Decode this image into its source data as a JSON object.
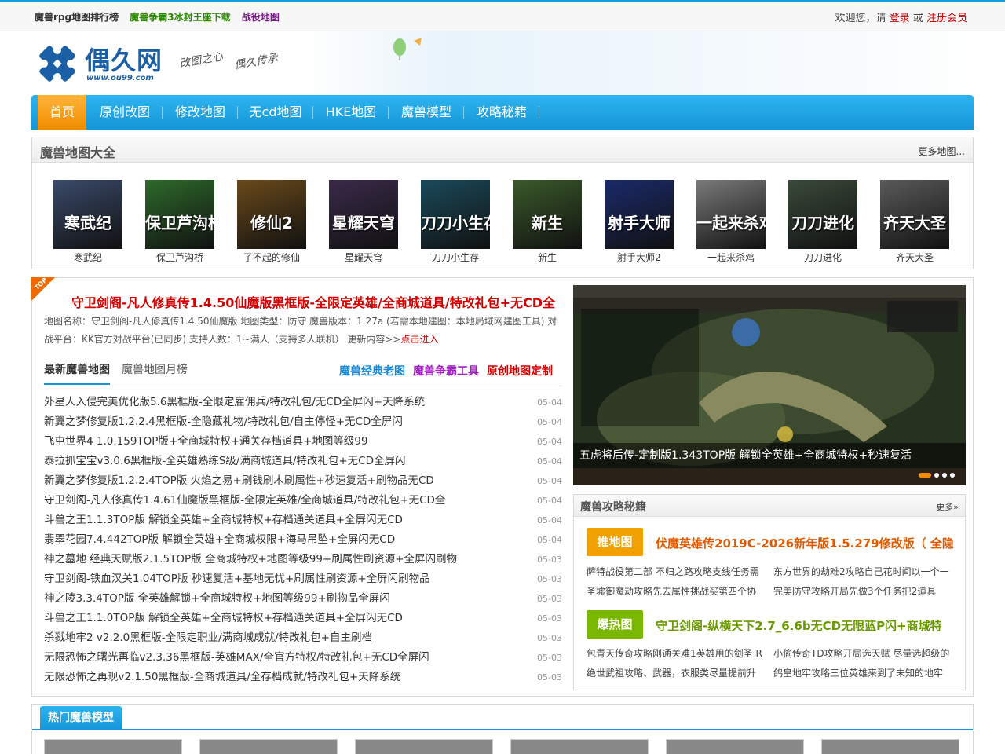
{
  "topbar": {
    "links": [
      {
        "label": "魔兽rpg地图排行榜",
        "color": "#333333"
      },
      {
        "label": "魔兽争霸3冰封王座下载",
        "color": "#2a8a00"
      },
      {
        "label": "战役地图",
        "color": "#7a1a8a"
      }
    ],
    "welcome": "欢迎您，请",
    "login": "登录",
    "or": "或",
    "register": "注册会员"
  },
  "header": {
    "logo_text": "偶久网",
    "logo_url": "www.ou99.com",
    "slogan_1": "改图之心",
    "slogan_2": "偶久传承"
  },
  "nav": {
    "items": [
      "首页",
      "原创改图",
      "修改地图",
      "无cd地图",
      "HKE地图",
      "魔兽模型",
      "攻略秘籍"
    ]
  },
  "maps_section": {
    "title": "魔兽地图大全",
    "more": "更多地图...",
    "items": [
      {
        "label": "寒武纪",
        "color": "#3a4a6a",
        "art": "寒武纪"
      },
      {
        "label": "保卫芦沟桥",
        "color": "#2d6a2a",
        "art": "保卫芦沟桥"
      },
      {
        "label": "了不起的修仙",
        "color": "#6a4a1a",
        "art": "修仙2"
      },
      {
        "label": "星耀天穹",
        "color": "#3a2a4a",
        "art": "星耀天穹"
      },
      {
        "label": "刀刀小生存",
        "color": "#1a4a5a",
        "art": "刀刀小生存"
      },
      {
        "label": "新生",
        "color": "#3a5a2a",
        "art": "新生"
      },
      {
        "label": "射手大师2",
        "color": "#1a2a6a",
        "art": "射手大师"
      },
      {
        "label": "一起来杀鸡",
        "color": "#7a7a7a",
        "art": "一起来杀鸡"
      },
      {
        "label": "刀刀进化",
        "color": "#3a4a3a",
        "art": "刀刀进化"
      },
      {
        "label": "齐天大圣",
        "color": "#5a5a5a",
        "art": "齐天大圣"
      }
    ]
  },
  "featured": {
    "tag": "TOP",
    "headline": "守卫剑阁-凡人修真传1.4.50仙魔版黑框版-全限定英雄/全商城道具/特改礼包+无CD全",
    "description": "地图名称：守卫剑阁-凡人修真传1.4.50仙魔版 地图类型：防守 魔兽版本：1.27a (若需本地建图：本地局域网建图工具) 对战平台：KK官方对战平台(已同步) 支持人数：1~满人（支持多人联机） 更新内容>>",
    "enter": "点击进入"
  },
  "tabs": {
    "latest": "最新魔兽地图",
    "monthly": "魔兽地图月榜",
    "links": [
      {
        "label": "魔兽经典老图",
        "color": "#1a8ad8"
      },
      {
        "label": "魔兽争霸工具",
        "color": "#a020c0"
      },
      {
        "label": "原创地图定制",
        "color": "#d20000"
      }
    ]
  },
  "latest_list": [
    {
      "title": "外星人入侵完美优化版5.6黑框版-全限定雇佣兵/特改礼包/无CD全屏闪+天降系统",
      "date": "05-04"
    },
    {
      "title": "新翼之梦修复版1.2.2.4黑框版-全隐藏礼物/特改礼包/自主停怪+无CD全屏闪",
      "date": "05-04"
    },
    {
      "title": "飞屯世界4 1.0.159TOP版+全商城特权+通关存档道具+地图等级99",
      "date": "05-04"
    },
    {
      "title": "泰拉抓宝宝v3.0.6黑框版-全英雄熟练S级/满商城道具/特改礼包+无CD全屏闪",
      "date": "05-04"
    },
    {
      "title": "新翼之梦修复版1.2.2.4TOP版 火焰之易+刷钱刷木刷属性+秒速复活+刷物品无CD",
      "date": "05-04"
    },
    {
      "title": "守卫剑阁-凡人修真传1.4.61仙魔版黑框版-全限定英雄/全商城道具/特改礼包+无CD全",
      "date": "05-04"
    },
    {
      "title": "斗兽之王1.1.3TOP版 解锁全英雄+全商城特权+存档通关道具+全屏闪无CD",
      "date": "05-04"
    },
    {
      "title": "翡翠花园7.4.442TOP版 解锁全英雄+全商城权限+海马吊坠+全屏闪无CD",
      "date": "05-04"
    },
    {
      "title": "神之墓地 经典天赋版2.1.5TOP版 全商城特权+地图等级99+刷属性刷资源+全屏闪刷物",
      "date": "05-03"
    },
    {
      "title": "守卫剑阁-铁血汉关1.04TOP版 秒速复活+基地无忧+刷属性刷资源+全屏闪刷物品",
      "date": "05-03"
    },
    {
      "title": "神之陵3.3.4TOP版 全英雄解锁+全商城特权+地图等级99+刷物品全屏闪",
      "date": "05-03"
    },
    {
      "title": "斗兽之王1.1.0TOP版 解锁全英雄+全商城特权+存档通关道具+全屏闪无CD",
      "date": "05-03"
    },
    {
      "title": "杀戮地牢2 v2.2.0黑框版-全限定职业/满商城成就/特改礼包+自主刷档",
      "date": "05-03"
    },
    {
      "title": "无限恐怖之曙光再临v2.3.36黑框版-英雄MAX/全官方特权/特改礼包+无CD全屏闪",
      "date": "05-03"
    },
    {
      "title": "无限恐怖之再现v2.1.50黑框版-全商城道具/全存档成就/特改礼包+天降系统",
      "date": "05-03"
    }
  ],
  "slideshow": {
    "caption": "五虎将后传-定制版1.343TOP版 解锁全英雄+全商城特权+秒速复活"
  },
  "guides": {
    "title": "魔兽攻略秘籍",
    "more": "更多»",
    "hot_badge": "推地图",
    "hot_title": "伏魔英雄传2019C-2026新年版1.5.279修改版（ 全隐",
    "hot_items": [
      "萨特战役第二部 不归之路攻略支线任务需",
      "东方世界的劫难2攻略自己花时间以一个一",
      "圣墟御魔劫攻略先去属性挑战买第四个协",
      "完美防守攻略开局先做3个任务把2道具"
    ],
    "burst_badge": "爆热图",
    "burst_title": "守卫剑阁-纵横天下2.7_6.6b无CD无限蓝P闪+商城特",
    "burst_items": [
      "包青天传奇攻略刚通关难1英雄用的剑圣 R",
      "小偷传奇TD攻略开局选天赋 尽量选超级的",
      "绝世武祖攻略、武器，衣服类尽量提前升",
      "鸽皇地牢攻略三位英雄来到了未知的地牢"
    ]
  },
  "models": {
    "title": "热门魔兽模型"
  },
  "colors": {
    "accent": "#1596d8",
    "active": "#f08c00",
    "red": "#d20000",
    "hot_orange": "#f0a000",
    "hot_text": "#e05a00",
    "burst_green": "#7ab800",
    "burst_text": "#6a9a00"
  }
}
